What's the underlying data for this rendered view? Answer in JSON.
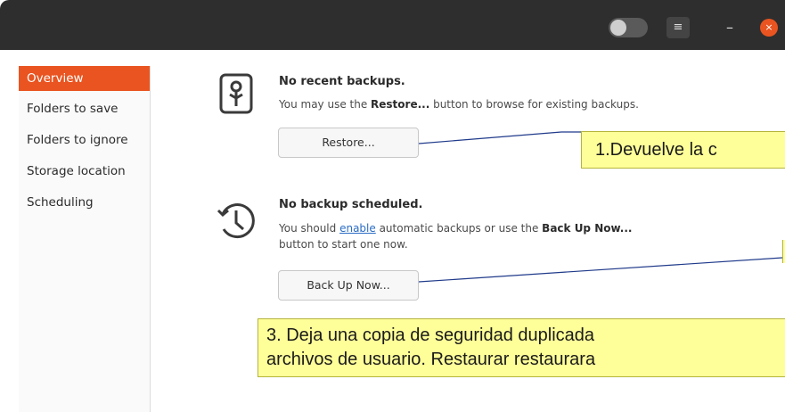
{
  "titlebar": {
    "toggle_icon": "toggle-switch-icon",
    "menu_icon": "hamburger-menu-icon",
    "menu_glyph": "≡",
    "minimize_glyph": "–",
    "close_glyph": "×"
  },
  "sidebar": {
    "items": [
      {
        "label": "Overview",
        "active": true
      },
      {
        "label": "Folders to save"
      },
      {
        "label": "Folders to ignore"
      },
      {
        "label": "Storage location"
      },
      {
        "label": "Scheduling"
      }
    ]
  },
  "backups": {
    "icon": "key-icon",
    "title": "No recent backups.",
    "desc_pre": "You may use the ",
    "desc_bold": "Restore...",
    "desc_post": " button to browse for existing backups.",
    "restore_label": "Restore..."
  },
  "schedule": {
    "icon": "clock-history-icon",
    "title": "No backup scheduled.",
    "desc_pre": "You should ",
    "desc_link": "enable",
    "desc_mid": " automatic backups or use the ",
    "desc_bold": "Back Up Now...",
    "desc_line2": "button to start one now.",
    "backup_label": "Back Up Now..."
  },
  "callouts": {
    "c1": "1.Devuelve la c",
    "c3_line1": "3. Deja una copia de seguridad duplicada",
    "c3_line2": "archivos de usuario. Restaurar restaurara"
  },
  "colors": {
    "accent": "#e95420",
    "titlebar": "#2e2e2e",
    "callout_fill": "#ffff99",
    "link": "#2a6cc4"
  }
}
